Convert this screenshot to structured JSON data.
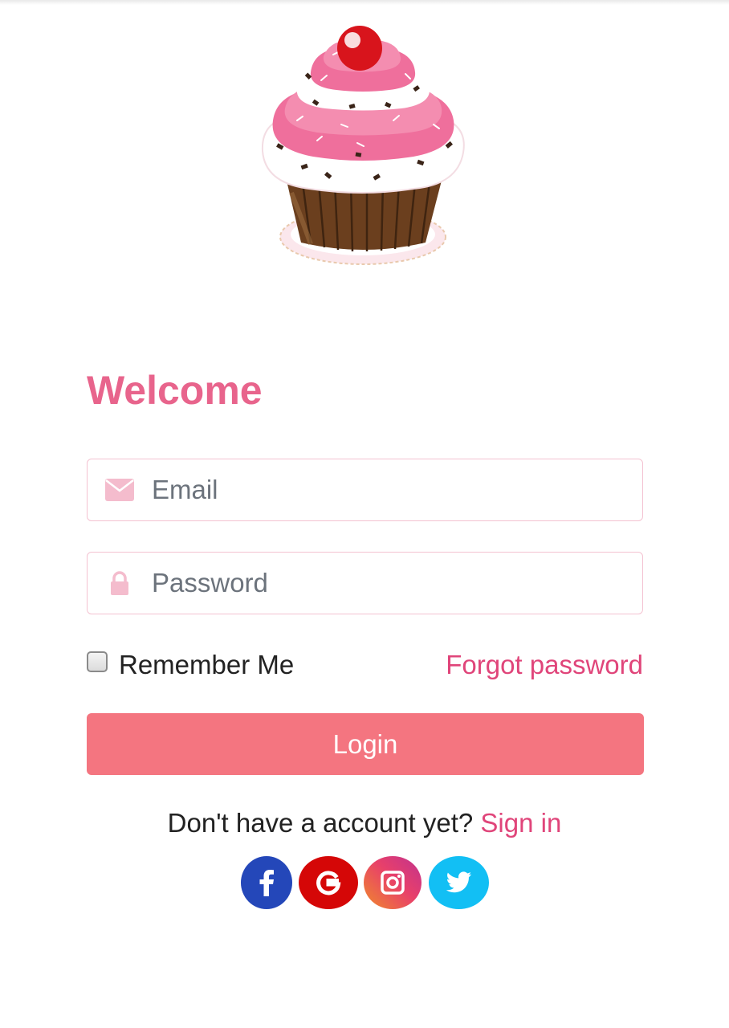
{
  "app": {
    "title": "Welcome"
  },
  "logo": {
    "icon": "cupcake-logo"
  },
  "form": {
    "email": {
      "placeholder": "Email",
      "value": "",
      "icon": "envelope-icon"
    },
    "password": {
      "placeholder": "Password",
      "value": "",
      "icon": "lock-icon"
    },
    "remember_label": "Remember Me",
    "remember_checked": false,
    "forgot_label": "Forgot password",
    "login_label": "Login"
  },
  "signup": {
    "prompt": "Don't have a account yet?",
    "link_label": "Sign in"
  },
  "social": [
    {
      "name": "facebook",
      "icon": "facebook-icon",
      "color": "#2447b9"
    },
    {
      "name": "google",
      "icon": "google-icon",
      "color": "#d50707"
    },
    {
      "name": "instagram",
      "icon": "instagram-icon",
      "color": "#e8406a"
    },
    {
      "name": "twitter",
      "icon": "twitter-icon",
      "color": "#12bff4"
    }
  ],
  "colors": {
    "accent": "#e8648c",
    "link": "#e0457a",
    "button": "#f47580",
    "border": "#f4c2d1",
    "icon": "#f4bccd"
  }
}
